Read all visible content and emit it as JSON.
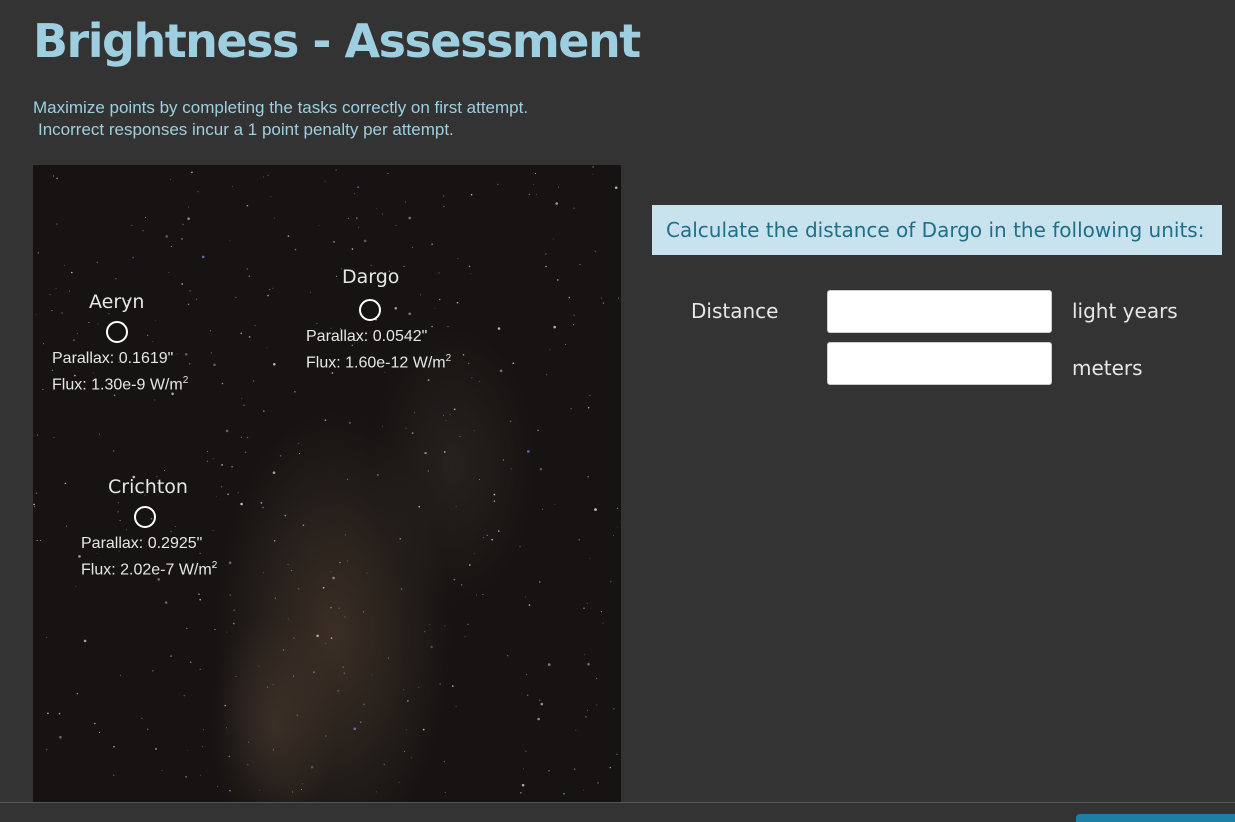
{
  "header": {
    "title": "Brightness - Assessment",
    "instructions_line1": "Maximize points by completing the tasks correctly on first attempt.",
    "instructions_line2": "Incorrect responses incur a 1 point penalty per attempt."
  },
  "sky_image": {
    "stars": [
      {
        "name": "Aeryn",
        "parallax": "Parallax:  0.1619\"",
        "flux": "Flux:  1.30e-9 W/m",
        "flux_sup": "2"
      },
      {
        "name": "Dargo",
        "parallax": "Parallax:  0.0542\"",
        "flux": "Flux:  1.60e-12 W/m",
        "flux_sup": "2"
      },
      {
        "name": "Crichton",
        "parallax": "Parallax:  0.2925\"",
        "flux": "Flux:  2.02e-7 W/m",
        "flux_sup": "2"
      }
    ]
  },
  "task": {
    "prompt": "Calculate the distance of Dargo in the following units:",
    "field_label": "Distance",
    "inputs": [
      {
        "value": "",
        "unit": "light years"
      },
      {
        "value": "",
        "unit": "meters"
      }
    ]
  },
  "colors": {
    "background": "#333333",
    "title": "#9ecfe0",
    "prompt_bg": "#c8e3ee",
    "prompt_text": "#1d6f8a",
    "accent": "#1d7fa3"
  }
}
